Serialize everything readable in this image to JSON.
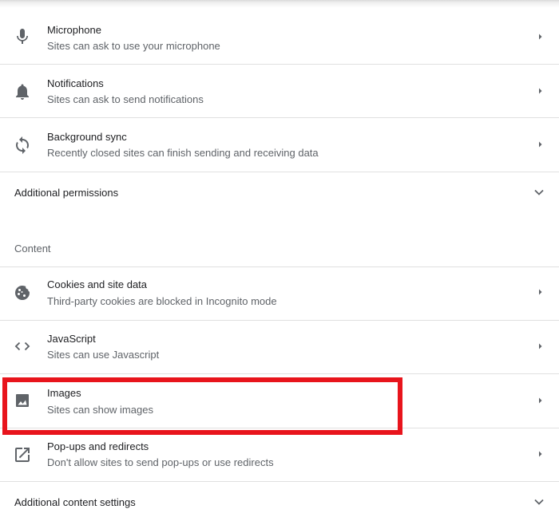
{
  "permissions": {
    "items": [
      {
        "title": "Microphone",
        "subtitle": "Sites can ask to use your microphone",
        "icon": "microphone-icon"
      },
      {
        "title": "Notifications",
        "subtitle": "Sites can ask to send notifications",
        "icon": "bell-icon"
      },
      {
        "title": "Background sync",
        "subtitle": "Recently closed sites can finish sending and receiving data",
        "icon": "sync-icon"
      }
    ],
    "additional_label": "Additional permissions"
  },
  "content": {
    "section_label": "Content",
    "items": [
      {
        "title": "Cookies and site data",
        "subtitle": "Third-party cookies are blocked in Incognito mode",
        "icon": "cookie-icon"
      },
      {
        "title": "JavaScript",
        "subtitle": "Sites can use Javascript",
        "icon": "code-icon"
      },
      {
        "title": "Images",
        "subtitle": "Sites can show images",
        "icon": "image-icon"
      },
      {
        "title": "Pop-ups and redirects",
        "subtitle": "Don't allow sites to send pop-ups or use redirects",
        "icon": "open-in-new-icon"
      }
    ],
    "additional_label": "Additional content settings"
  },
  "colors": {
    "highlight": "#e8141c",
    "icon": "#5f6368",
    "divider": "#e0e0e0"
  }
}
